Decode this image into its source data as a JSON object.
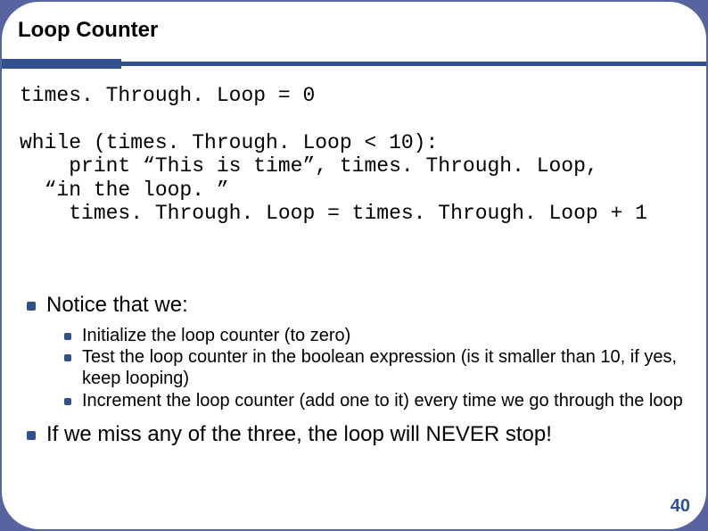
{
  "title": "Loop Counter",
  "code": {
    "line1": "times. Through. Loop = 0",
    "line2": "while (times. Through. Loop < 10):",
    "line3": "    print “This is time”, times. Through. Loop,",
    "line4": "“in the loop. ”",
    "line5": "    times. Through. Loop = times. Through. Loop + 1"
  },
  "bullets": {
    "b1": "Notice that we:",
    "sub": [
      "Initialize the loop counter (to zero)",
      "Test the loop counter in the boolean expression (is it smaller than 10, if yes, keep looping)",
      "Increment the loop counter (add one to it) every time we go through the loop"
    ],
    "b2": "If we miss any of the three, the loop will NEVER stop!"
  },
  "page_number": "40"
}
